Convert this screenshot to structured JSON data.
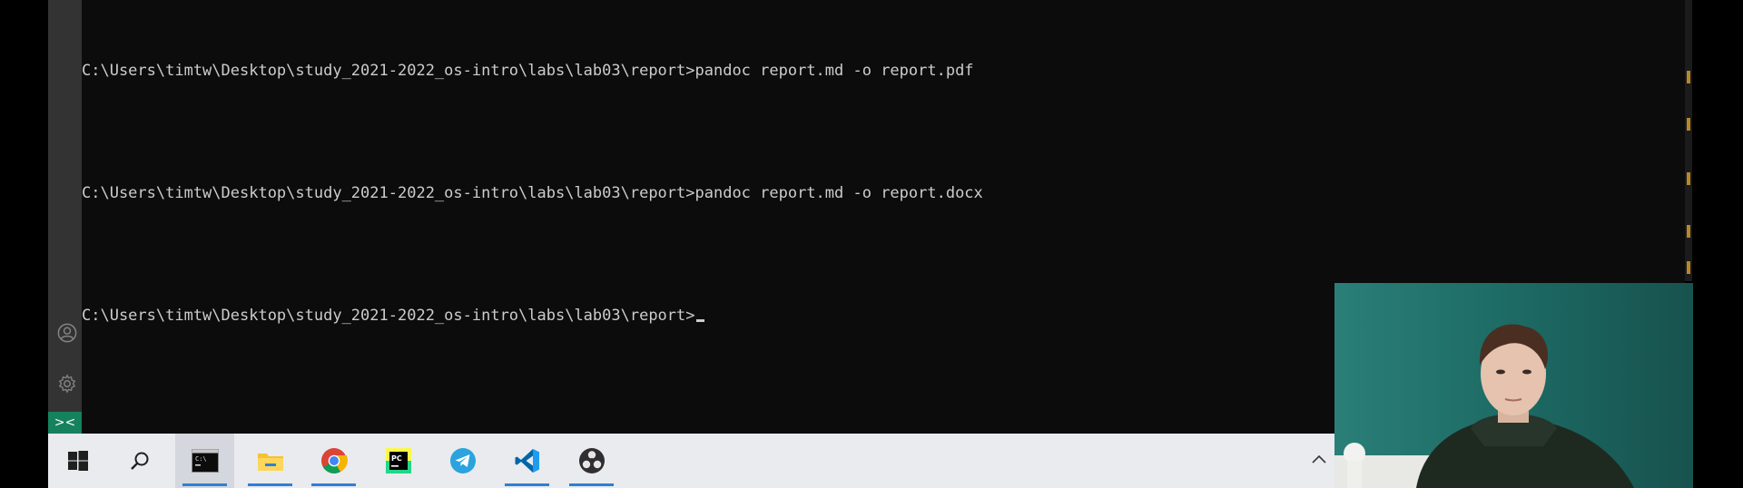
{
  "terminal": {
    "lines": [
      "C:\\Users\\timtw\\Desktop\\study_2021-2022_os-intro\\labs\\lab03\\report>pandoc report.md -o report.pdf",
      "C:\\Users\\timtw\\Desktop\\study_2021-2022_os-intro\\labs\\lab03\\report>pandoc report.md -o report.docx",
      "C:\\Users\\timtw\\Desktop\\study_2021-2022_os-intro\\labs\\lab03\\report>"
    ]
  },
  "activity_bar": {
    "icons": [
      "account-icon",
      "gear-icon"
    ],
    "remote_indicator_glyph": "><"
  },
  "taskbar": {
    "items": [
      {
        "name": "start-button",
        "icon": "windows-logo-icon",
        "open": false,
        "active": false
      },
      {
        "name": "search-button",
        "icon": "search-icon",
        "open": false,
        "active": false
      },
      {
        "name": "taskbar-terminal",
        "icon": "command-prompt-icon",
        "open": true,
        "active": true
      },
      {
        "name": "taskbar-file-explorer",
        "icon": "folder-icon",
        "open": true,
        "active": false
      },
      {
        "name": "taskbar-chrome",
        "icon": "chrome-icon",
        "open": true,
        "active": false
      },
      {
        "name": "taskbar-pycharm",
        "icon": "pycharm-icon",
        "open": false,
        "active": false
      },
      {
        "name": "taskbar-telegram",
        "icon": "telegram-icon",
        "open": false,
        "active": false
      },
      {
        "name": "taskbar-vscode",
        "icon": "vscode-icon",
        "open": true,
        "active": false
      },
      {
        "name": "taskbar-obs",
        "icon": "obs-icon",
        "open": true,
        "active": false
      }
    ],
    "tray_chevron": "^",
    "pycharm_label": "PC"
  },
  "colors": {
    "terminal_bg": "#0c0c0c",
    "terminal_text": "#cccccc",
    "taskbar_bg": "#e9ebef",
    "taskbar_underline": "#2f7fd3",
    "remote_indicator": "#16825d"
  }
}
